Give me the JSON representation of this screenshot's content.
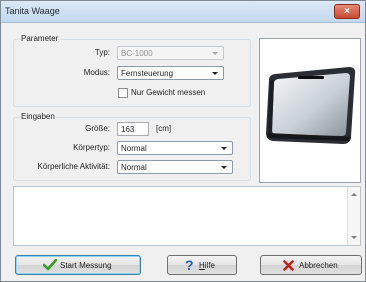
{
  "window": {
    "title": "Tanita Waage",
    "close_glyph": "×"
  },
  "parameter": {
    "legend": "Parameter",
    "typ_label": "Typ:",
    "typ_value": "BC-1000",
    "modus_label": "Modus:",
    "modus_value": "Fernsteuerung",
    "checkbox_label": "Nur Gewicht messen",
    "checkbox_checked": false
  },
  "eingaben": {
    "legend": "Eingaben",
    "groesse_label": "Größe:",
    "groesse_value": "163",
    "groesse_unit": "[cm]",
    "koerpertyp_label": "Körpertyp:",
    "koerpertyp_value": "Normal",
    "aktivitaet_label": "Körperliche Aktivität:",
    "aktivitaet_value": "Normal"
  },
  "log": {
    "text": ""
  },
  "buttons": {
    "start_label": "Start Messung",
    "help_hotkey": "H",
    "help_rest": "ilfe",
    "cancel_label": "Abbrechen"
  },
  "icons": {
    "start": "checkmark-icon",
    "help": "question-icon",
    "cancel": "x-icon",
    "close": "close-icon"
  },
  "colors": {
    "titlebar": "#c3d7ee",
    "close": "#c64b32",
    "check": "#3a9a24",
    "help": "#1e5fb3",
    "cancel": "#c0201a"
  }
}
